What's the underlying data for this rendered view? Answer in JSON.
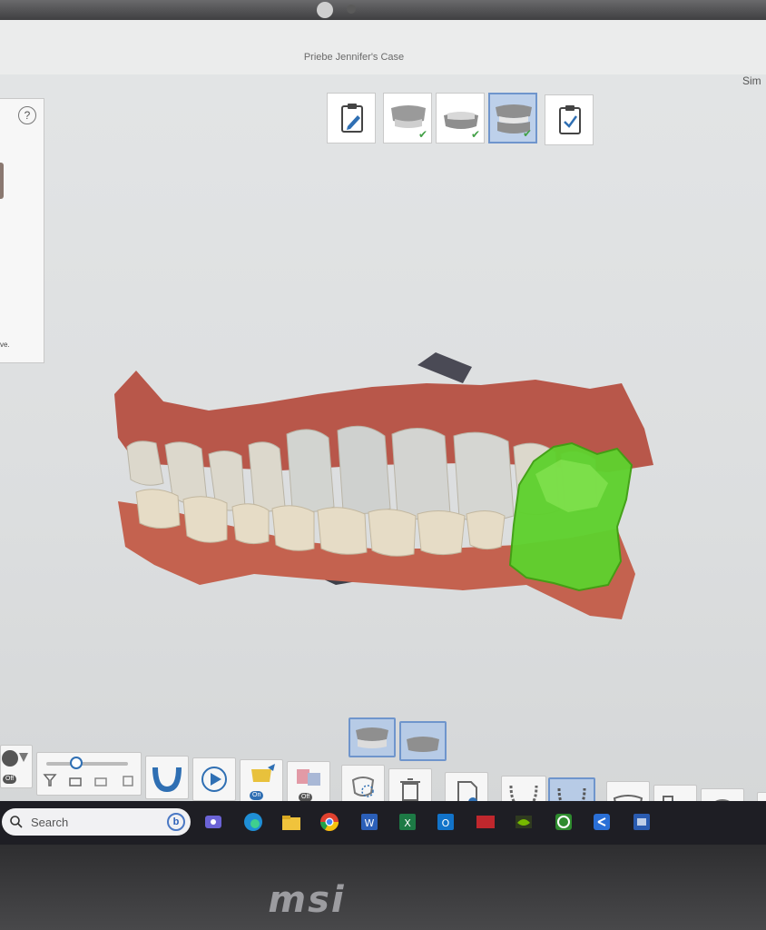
{
  "window": {
    "title": "Priebe Jennifer's Case",
    "title_right": "Sim"
  },
  "left_panel": {
    "help_glyph": "?",
    "text_fragment": "ve."
  },
  "workflow_steps": [
    {
      "icon": "clipboard-edit-icon",
      "checked": false,
      "active": false
    },
    {
      "icon": "upper-jaw-scan-icon",
      "checked": true,
      "active": false
    },
    {
      "icon": "lower-jaw-scan-icon",
      "checked": true,
      "active": false
    },
    {
      "icon": "bite-scan-icon",
      "checked": true,
      "active": true
    },
    {
      "icon": "clipboard-check-icon",
      "checked": false,
      "active": false
    }
  ],
  "toolbar": {
    "toggle_off_label": "Off",
    "toggle_on_label": "On",
    "ai_toggle_off_label": "Off"
  },
  "taskbar": {
    "search_placeholder": "Search",
    "bing_glyph": "b",
    "apps": [
      "teams-icon",
      "edge-icon",
      "file-explorer-icon",
      "chrome-icon",
      "word-icon",
      "excel-icon",
      "outlook-icon",
      "app-red-icon",
      "nvidia-icon",
      "xbox-icon",
      "share-icon",
      "app-blue-icon"
    ]
  },
  "device": {
    "brand": "msi"
  },
  "colors": {
    "accent": "#6f95cc",
    "active_fill": "#bdd0ea",
    "check": "#43a047",
    "overlay": "#5fd12e"
  }
}
